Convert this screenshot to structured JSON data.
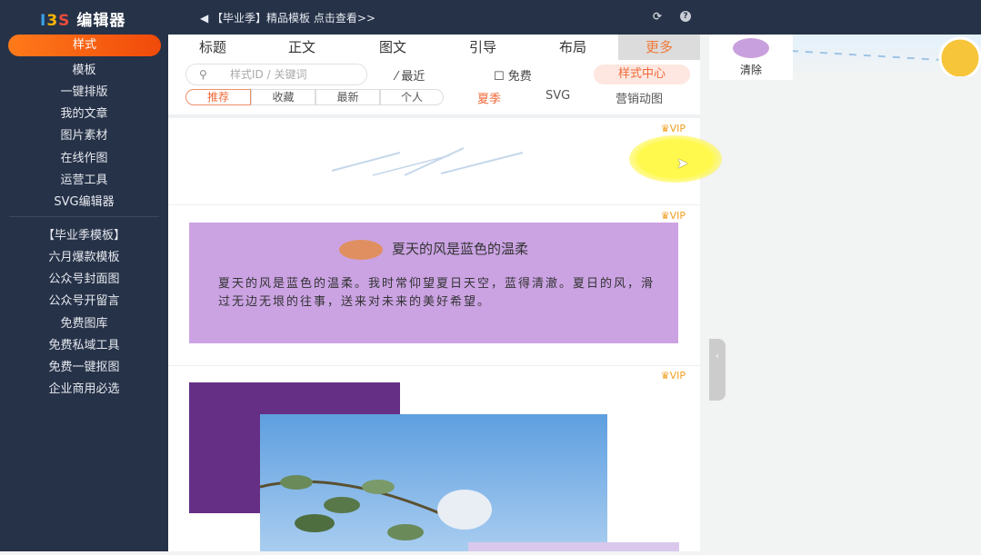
{
  "header": {
    "logo_letters": [
      "I",
      "3",
      "S"
    ],
    "logo_text": "编辑器",
    "notice": "◀︎ 【毕业季】精品模板 点击查看>>"
  },
  "sidebar": {
    "items": [
      "样式",
      "模板",
      "一键排版",
      "我的文章",
      "图片素材",
      "在线作图",
      "运营工具",
      "SVG编辑器"
    ],
    "extras": [
      "【毕业季模板】",
      "六月爆款模板",
      "公众号封面图",
      "公众号开留言",
      "免费图库",
      "免费私域工具",
      "免费一键抠图",
      "企业商用必选"
    ]
  },
  "tabs": [
    "标题",
    "正文",
    "图文",
    "引导",
    "布局",
    "更多"
  ],
  "toolbar": {
    "search_placeholder": "样式ID / 关键词",
    "recent": "最近",
    "free": "免费",
    "style_center": "样式中心"
  },
  "filters": [
    "推荐",
    "收藏",
    "最新",
    "个人"
  ],
  "categories": [
    "夏季",
    "SVG",
    "营销动图"
  ],
  "cards": {
    "vip": "VIP",
    "title": "夏天的风是蓝色的温柔",
    "body": "夏天的风是蓝色的温柔。我时常仰望夏日天空，蓝得清澈。夏日的风，滑过无边无垠的往事，送来对未来的美好希望。"
  },
  "clear_label": "清除",
  "colors": {
    "accent": "#f06a3a",
    "sidebar": "#263248",
    "purple": "#cba3e3"
  }
}
